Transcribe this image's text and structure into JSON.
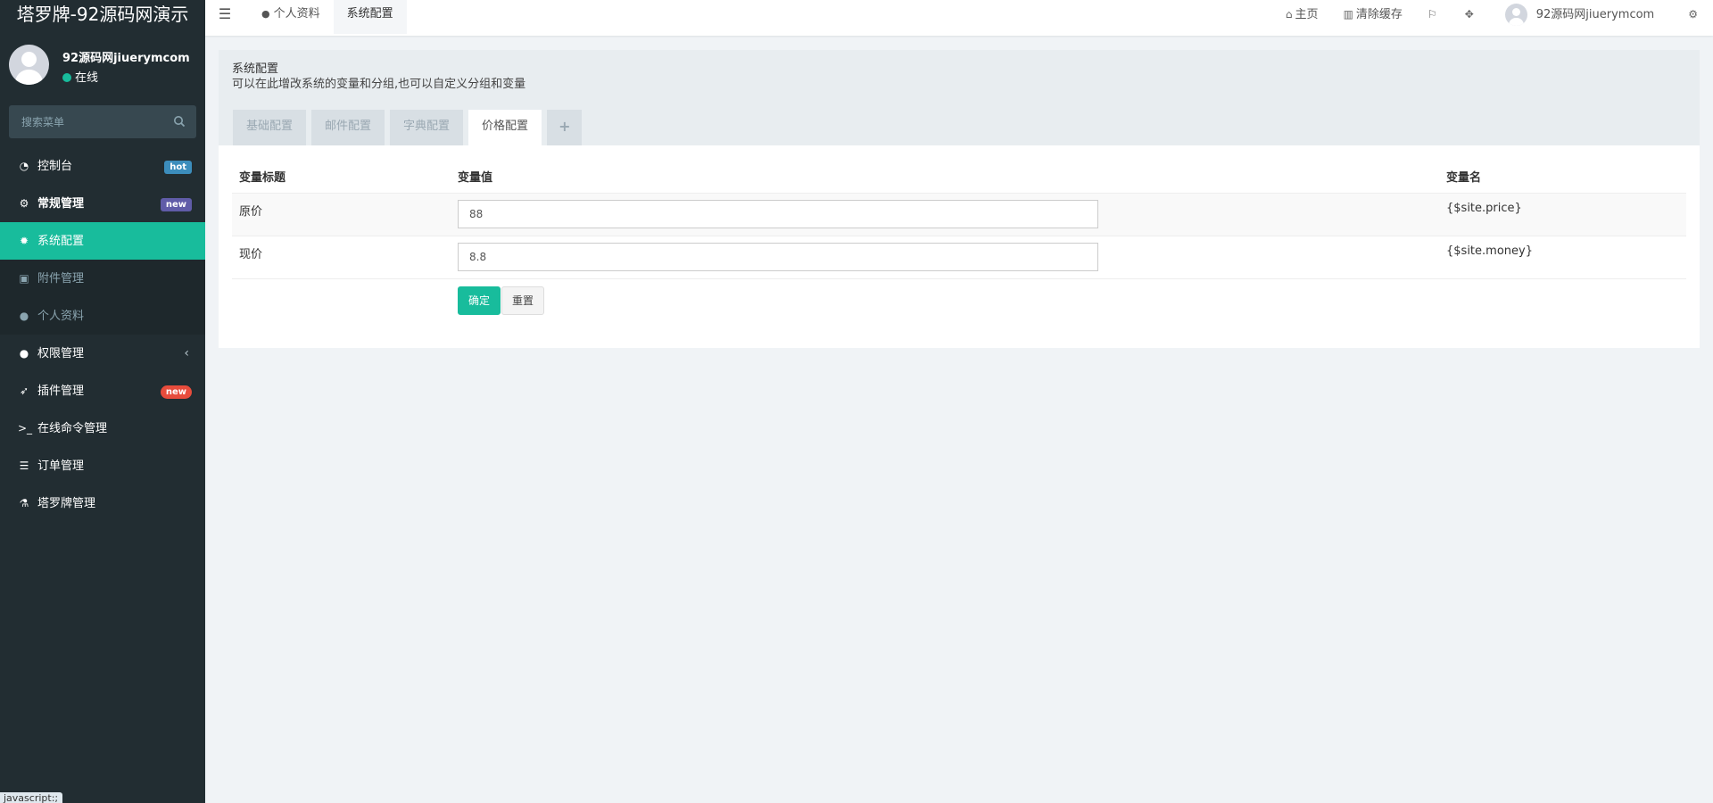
{
  "brand": "塔罗牌-92源码网演示",
  "user": {
    "name": "92源码网jiuerymcom",
    "status": "在线"
  },
  "search": {
    "placeholder": "搜索菜单"
  },
  "sidebar": {
    "items": [
      {
        "label": "控制台",
        "icon": "dashboard-icon",
        "badge": "hot"
      },
      {
        "label": "常规管理",
        "icon": "cogs-icon",
        "badge": "new"
      },
      {
        "label": "系统配置",
        "icon": "gear-icon"
      },
      {
        "label": "附件管理",
        "icon": "image-icon"
      },
      {
        "label": "个人资料",
        "icon": "user-icon"
      },
      {
        "label": "权限管理",
        "icon": "group-icon"
      },
      {
        "label": "插件管理",
        "icon": "rocket-icon",
        "badge": "new"
      },
      {
        "label": "在线命令管理",
        "icon": "terminal-icon"
      },
      {
        "label": "订单管理",
        "icon": "list-icon"
      },
      {
        "label": "塔罗牌管理",
        "icon": "flask-icon"
      }
    ]
  },
  "js_tip": "javascript:;",
  "topbar": {
    "tabs": [
      {
        "label": "个人资料",
        "icon": "user-icon"
      },
      {
        "label": "系统配置"
      }
    ],
    "right": {
      "home": "主页",
      "clear_cache": "清除缓存",
      "username": "92源码网jiuerymcom"
    }
  },
  "panel": {
    "title": "系统配置",
    "description": "可以在此增改系统的变量和分组,也可以自定义分组和变量",
    "tabs": [
      "基础配置",
      "邮件配置",
      "字典配置",
      "价格配置"
    ],
    "table": {
      "headers": [
        "变量标题",
        "变量值",
        "变量名"
      ],
      "rows": [
        {
          "title": "原价",
          "value": "88",
          "name": "{$site.price}"
        },
        {
          "title": "现价",
          "value": "8.8",
          "name": "{$site.money}"
        }
      ]
    },
    "buttons": {
      "ok": "确定",
      "reset": "重置"
    }
  },
  "colors": {
    "accent": "#18bc9c",
    "sidebar_bg": "#222d32",
    "badge_hot": "#3c8dbc",
    "badge_new": "#605ca8",
    "badge_new_red": "#e74c3c"
  }
}
